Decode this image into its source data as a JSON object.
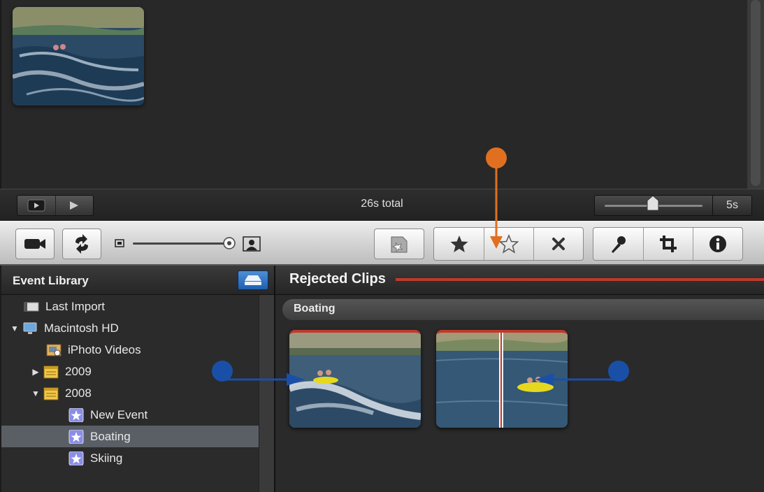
{
  "project": {
    "total": "26s total",
    "zoom_value": "5s"
  },
  "sidebar": {
    "title": "Event Library",
    "items": [
      {
        "label": "Last Import",
        "icon": "film-strip-icon",
        "disclosure": ""
      },
      {
        "label": "Macintosh HD",
        "icon": "computer-icon",
        "disclosure": "▼"
      },
      {
        "label": "iPhoto Videos",
        "icon": "iphoto-icon",
        "disclosure": ""
      },
      {
        "label": "2009",
        "icon": "calendar-icon",
        "disclosure": "▶"
      },
      {
        "label": "2008",
        "icon": "calendar-icon",
        "disclosure": "▼"
      },
      {
        "label": "New Event",
        "icon": "star-event-icon",
        "disclosure": ""
      },
      {
        "label": "Boating",
        "icon": "star-event-icon",
        "disclosure": "",
        "selected": true
      },
      {
        "label": "Skiing",
        "icon": "star-event-icon",
        "disclosure": ""
      }
    ]
  },
  "browser": {
    "title": "Rejected Clips",
    "event": "Boating"
  },
  "colors": {
    "callout_orange": "#e07020",
    "callout_blue": "#1a4fa8",
    "rejected_line": "#c0392b",
    "selection": "#5a5f66"
  }
}
